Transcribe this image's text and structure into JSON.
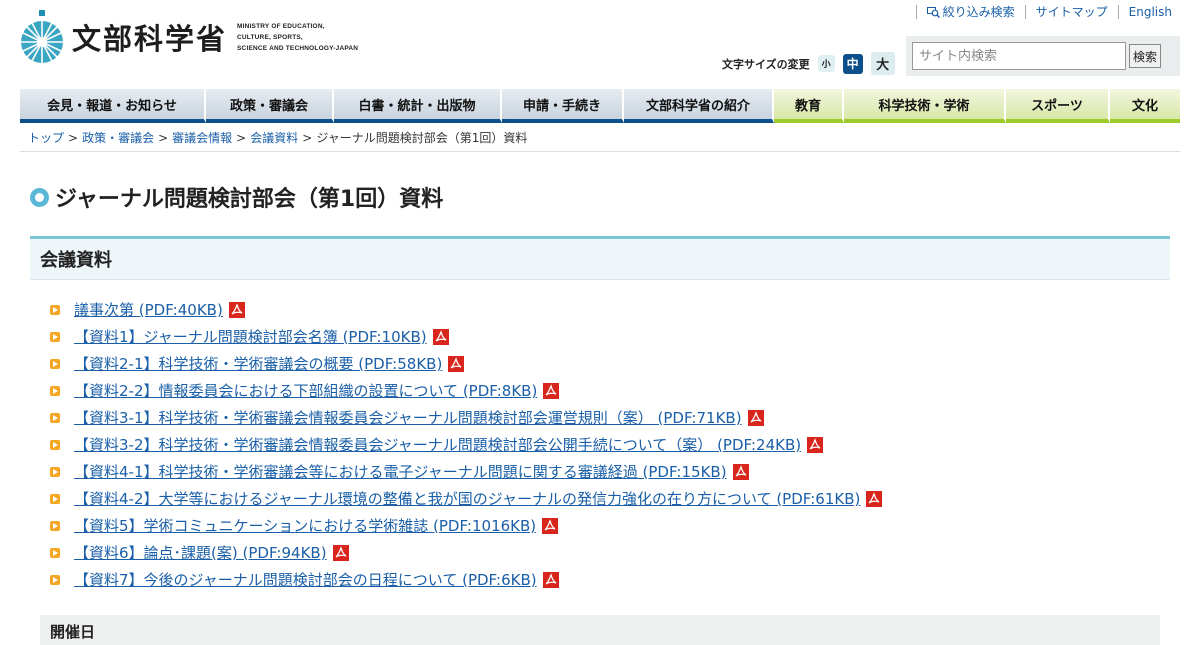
{
  "header": {
    "logo_kanji": "文部科学省",
    "logo_en": [
      "MINISTRY OF EDUCATION,",
      "CULTURE, SPORTS,",
      "SCIENCE AND TECHNOLOGY-JAPAN"
    ],
    "links": {
      "narrow_search": "絞り込み検索",
      "sitemap": "サイトマップ",
      "english": "English"
    },
    "font_size": {
      "label": "文字サイズの変更",
      "small": "小",
      "medium": "中",
      "large": "大"
    },
    "search": {
      "placeholder": "サイト内検索",
      "button": "検索"
    }
  },
  "nav": {
    "items": [
      "会見・報道・お知らせ",
      "政策・審議会",
      "白書・統計・出版物",
      "申請・手続き",
      "文部科学省の紹介",
      "教育",
      "科学技術・学術",
      "スポーツ",
      "文化"
    ]
  },
  "breadcrumb": {
    "items": [
      "トップ",
      "政策・審議会",
      "審議会情報",
      "会議資料"
    ],
    "current": "ジャーナル問題検討部会（第1回）資料"
  },
  "page_title": "ジャーナル問題検討部会（第1回）資料",
  "section": {
    "title": "会議資料",
    "documents": [
      "議事次第 (PDF:40KB)",
      "【資料1】ジャーナル問題検討部会名簿 (PDF:10KB)",
      "【資料2-1】科学技術・学術審議会の概要 (PDF:58KB)",
      "【資料2-2】情報委員会における下部組織の設置について (PDF:8KB)",
      "【資料3-1】科学技術・学術審議会情報委員会ジャーナル問題検討部会運営規則（案） (PDF:71KB)",
      "【資料3-2】科学技術・学術審議会情報委員会ジャーナル問題検討部会公開手続について（案） (PDF:24KB)",
      "【資料4-1】科学技術・学術審議会等における電子ジャーナル問題に関する審議経過 (PDF:15KB)",
      "【資料4-2】大学等におけるジャーナル環境の整備と我が国のジャーナルの発信力強化の在り方について (PDF:61KB)",
      "【資料5】学術コミュニケーションにおける学術雑誌 (PDF:1016KB)",
      "【資料6】論点･課題(案) (PDF:94KB)",
      "【資料7】今後のジャーナル問題検討部会の日程について (PDF:6KB)"
    ]
  },
  "next_section": {
    "title": "開催日"
  },
  "colors": {
    "link": "#1a5fa8",
    "nav_blue": "#0d4f8a",
    "nav_green": "#9ecb2a",
    "accent": "#7cc3d6"
  }
}
